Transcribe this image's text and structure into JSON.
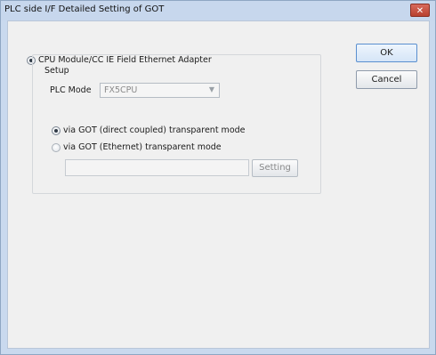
{
  "window": {
    "title": "PLC side I/F Detailed Setting of GOT",
    "close_label": "✕"
  },
  "options": {
    "cpu_module_label": "CPU Module/CC IE Field Ethernet Adapter",
    "setup_caption": "Setup",
    "plc_mode_label": "PLC Mode",
    "plc_mode_value": "FX5CPU",
    "direct_coupled_label": "via GOT (direct coupled) transparent mode",
    "ethernet_label": "via GOT (Ethernet) transparent mode",
    "ethernet_field_value": "",
    "setting_button": "Setting"
  },
  "buttons": {
    "ok": "OK",
    "cancel": "Cancel"
  },
  "colors": {
    "title_bar": "#c7d7ed",
    "close_button": "#c4483a",
    "client_bg": "#f0f0f0"
  }
}
